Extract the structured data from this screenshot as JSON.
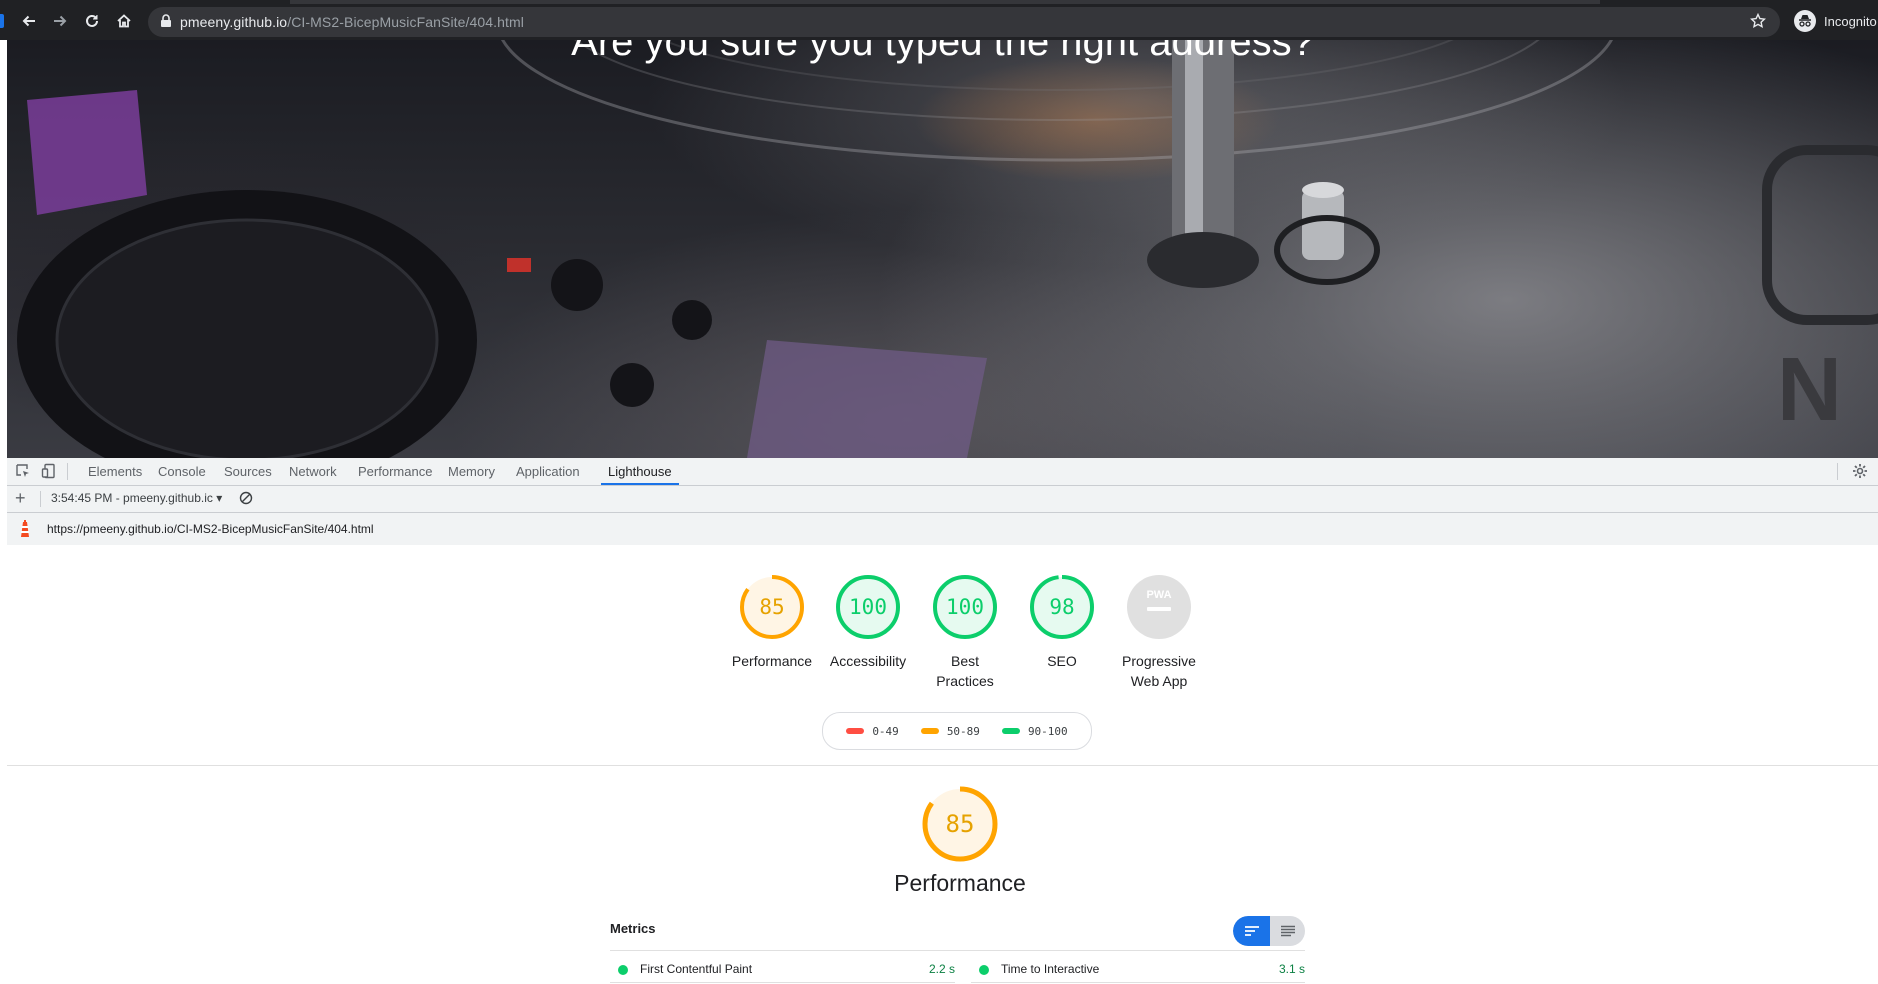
{
  "browser": {
    "url_host": "pmeeny.github.io",
    "url_path": "/CI-MS2-BicepMusicFanSite/404.html",
    "profile_label": "Incognito"
  },
  "page": {
    "hero_text": "Are you sure you typed the right address?"
  },
  "devtools": {
    "tabs": [
      "Elements",
      "Console",
      "Sources",
      "Network",
      "Performance",
      "Memory",
      "Application",
      "Lighthouse"
    ],
    "active_tab": "Lighthouse",
    "report_select": "3:54:45 PM - pmeeny.github.ic",
    "report_url": "https://pmeeny.github.io/CI-MS2-BicepMusicFanSite/404.html"
  },
  "lighthouse": {
    "categories": [
      {
        "label": "Performance",
        "score": 85,
        "rating": "average"
      },
      {
        "label": "Accessibility",
        "score": 100,
        "rating": "pass"
      },
      {
        "label": "Best Practices",
        "score": 100,
        "rating": "pass"
      },
      {
        "label": "SEO",
        "score": 98,
        "rating": "pass"
      },
      {
        "label": "Progressive Web App",
        "score": null,
        "rating": "na",
        "badge": "PWA"
      }
    ],
    "legend": [
      {
        "range": "0-49",
        "color": "#ff4e42"
      },
      {
        "range": "50-89",
        "color": "#ffa400"
      },
      {
        "range": "90-100",
        "color": "#0cce6b"
      }
    ],
    "performance": {
      "score": 85,
      "title": "Performance",
      "metrics_title": "Metrics",
      "metrics": [
        {
          "name": "First Contentful Paint",
          "value": "2.2 s",
          "rating": "pass"
        },
        {
          "name": "Time to Interactive",
          "value": "3.1 s",
          "rating": "pass"
        }
      ]
    }
  },
  "colors": {
    "pass": "#0cce6b",
    "average": "#ffa400",
    "fail": "#ff4e42",
    "accent": "#1a73e8"
  }
}
